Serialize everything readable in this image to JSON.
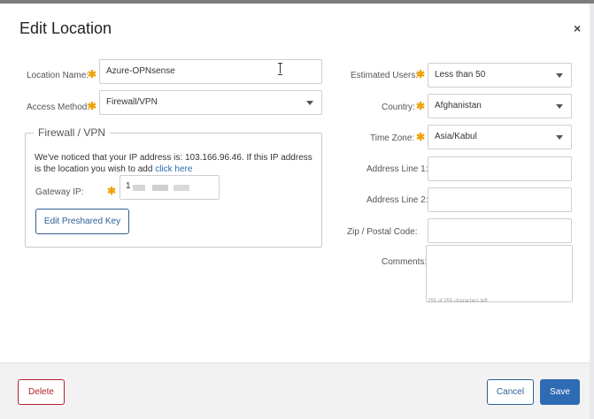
{
  "dialog": {
    "title": "Edit Location",
    "close_glyph": "×"
  },
  "left": {
    "location_name": {
      "label": "Location Name:",
      "value": "Azure-OPNsense"
    },
    "access_method": {
      "label": "Access Method:",
      "value": "Firewall/VPN"
    }
  },
  "firewall": {
    "legend": "Firewall / VPN",
    "notice_text": "We've noticed that your IP address is: 103.166.96.46. If this IP address is the location you wish to add ",
    "notice_link": "click here",
    "gateway_label": "Gateway IP:",
    "gateway_value_visible": "1",
    "edit_key_button": "Edit Preshared Key"
  },
  "right": {
    "estimated_users": {
      "label": "Estimated Users:",
      "value": "Less than 50"
    },
    "country": {
      "label": "Country:",
      "value": "Afghanistan"
    },
    "time_zone": {
      "label": "Time Zone:",
      "value": "Asia/Kabul"
    },
    "address1": {
      "label": "Address Line 1:",
      "value": ""
    },
    "address2": {
      "label": "Address Line 2:",
      "value": ""
    },
    "zip": {
      "label": "Zip / Postal Code:",
      "value": ""
    },
    "comments": {
      "label": "Comments:",
      "value": "",
      "counter": "255 of 255 characters left"
    }
  },
  "footer": {
    "delete": "Delete",
    "cancel": "Cancel",
    "save": "Save"
  },
  "colors": {
    "required_marker": "#f0a30a",
    "primary": "#2f6bb3",
    "danger": "#b5202a",
    "link": "#2a6db0"
  },
  "required_marker_glyph": "✱"
}
